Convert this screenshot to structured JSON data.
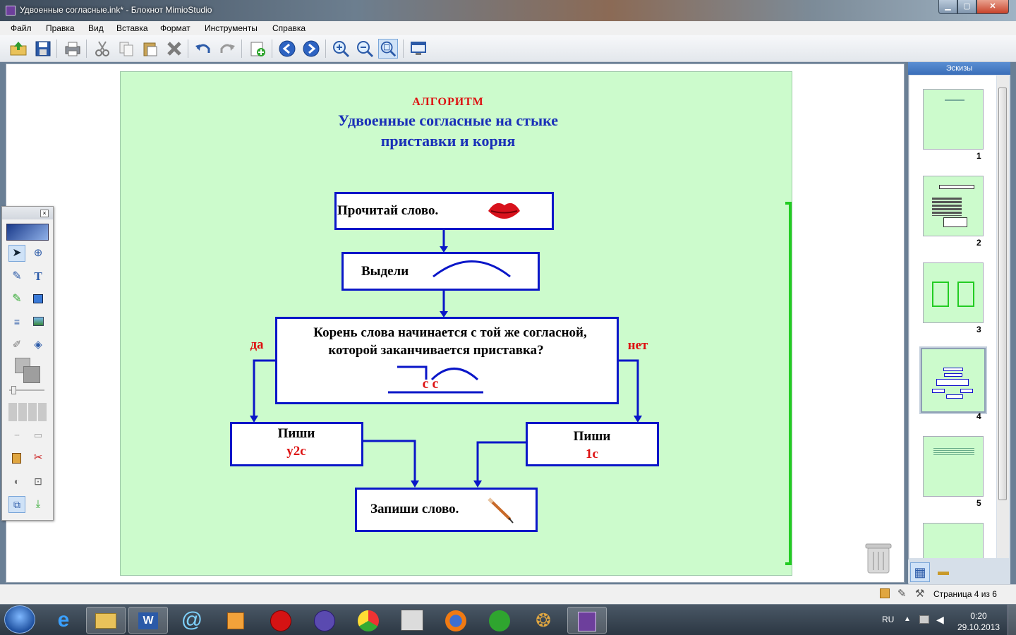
{
  "window": {
    "title": "Удвоенные согласные.ink* - Блокнот MimioStudio"
  },
  "menu": [
    "Файл",
    "Правка",
    "Вид",
    "Вставка",
    "Формат",
    "Инструменты",
    "Справка"
  ],
  "toolbar_icons": [
    "open-icon",
    "save-icon",
    "print-icon",
    "cut-icon",
    "copy-icon",
    "paste-icon",
    "delete-icon",
    "undo-icon",
    "redo-icon",
    "new-page-icon",
    "back-icon",
    "forward-icon",
    "zoom-in-icon",
    "zoom-out-icon",
    "zoom-fit-icon",
    "screen-icon"
  ],
  "slide": {
    "heading": "АЛГОРИТМ",
    "title_line1": "Удвоенные согласные на стыке",
    "title_line2": "приставки и корня",
    "box1": "Прочитай слово.",
    "box2": "Выдели",
    "box3_line1": "Корень слова начинается с той же согласной,",
    "box3_line2": "которой заканчивается приставка?",
    "box3_letters": "с с",
    "yes": "да",
    "no": "нет",
    "box_left_l1": "Пиши",
    "box_left_l2": "у2с",
    "box_right_l1": "Пиши",
    "box_right_l2": "1с",
    "box_final": "Запиши слово."
  },
  "thumbnails": {
    "header": "Эскизы",
    "pages": [
      "1",
      "2",
      "3",
      "4",
      "5"
    ],
    "selected": "4"
  },
  "status": {
    "page": "Страница 4 из 6"
  },
  "taskbar": {
    "lang": "RU",
    "time": "0:20",
    "date": "29.10.2013"
  },
  "colors": {
    "slide_bg": "#ccfbcc",
    "box_border": "#0a16c8",
    "title_blue": "#1a30b8",
    "accent_red": "#dd1111",
    "green_bar": "#22cc22"
  }
}
